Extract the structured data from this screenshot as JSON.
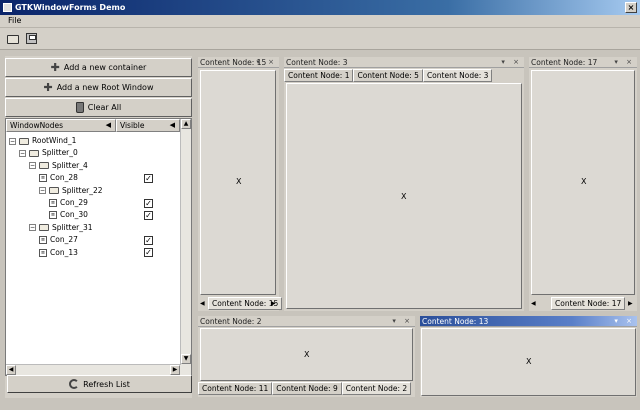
{
  "window": {
    "title": "GTKWindowForms Demo",
    "close_glyph": "×"
  },
  "menu": {
    "items": [
      "File"
    ]
  },
  "toolbar": {
    "icons": [
      "open-folder-icon",
      "save-disk-icon"
    ]
  },
  "left_panel": {
    "add_container_label": "Add a new container",
    "add_root_label": "Add a new Root Window",
    "clear_all_label": "Clear All",
    "columns": [
      "WindowNodes",
      "Visible"
    ],
    "tree": [
      {
        "label": "RootWind_1",
        "level": 0,
        "kind": "folder",
        "checked": false,
        "has_check": false
      },
      {
        "label": "Splitter_0",
        "level": 1,
        "kind": "folder",
        "checked": false,
        "has_check": false
      },
      {
        "label": "Splitter_4",
        "level": 2,
        "kind": "folder",
        "checked": false,
        "has_check": false
      },
      {
        "label": "Con_28",
        "level": 3,
        "kind": "leaf",
        "checked": true,
        "has_check": true
      },
      {
        "label": "Splitter_22",
        "level": 3,
        "kind": "folder",
        "checked": false,
        "has_check": false
      },
      {
        "label": "Con_29",
        "level": 4,
        "kind": "leaf",
        "checked": true,
        "has_check": true
      },
      {
        "label": "Con_30",
        "level": 4,
        "kind": "leaf",
        "checked": true,
        "has_check": true
      },
      {
        "label": "Splitter_31",
        "level": 2,
        "kind": "folder",
        "checked": false,
        "has_check": false
      },
      {
        "label": "Con_27",
        "level": 3,
        "kind": "leaf",
        "checked": true,
        "has_check": true
      },
      {
        "label": "Con_13",
        "level": 3,
        "kind": "leaf",
        "checked": true,
        "has_check": true
      }
    ],
    "refresh_label": "Refresh List"
  },
  "panes": {
    "left_top": {
      "title": "Content Node: 15",
      "body": "X",
      "tab": "Content Node: 15"
    },
    "center_top": {
      "title": "Content Node: 3",
      "tabs": [
        "Content Node: 1",
        "Content Node: 5",
        "Content Node: 3"
      ],
      "body": "X"
    },
    "right_top": {
      "title": "Content Node: 17",
      "body": "X",
      "tab": "Content Node: 17"
    },
    "bottom_left": {
      "title": "Content Node: 2",
      "body": "X",
      "tabs": [
        "Content Node: 11",
        "Content Node: 9",
        "Content Node: 2"
      ]
    },
    "bottom_right": {
      "title": "Content Node: 13",
      "body": "X"
    }
  },
  "pane_controls": "▾ ×",
  "colors": {
    "active_title": "#2b4f9a",
    "window_title": "#0a246a"
  }
}
